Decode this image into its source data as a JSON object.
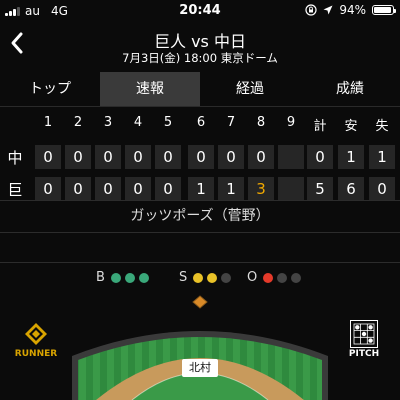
{
  "status": {
    "carrier": "au",
    "network": "4G",
    "time": "20:44",
    "battery": "94%",
    "battery_level": 0.94
  },
  "header": {
    "title": "巨人 vs 中日",
    "subtitle": "7月3日(金) 18:00 東京ドーム"
  },
  "tabs": [
    {
      "label": "トップ",
      "active": false
    },
    {
      "label": "速報",
      "active": true
    },
    {
      "label": "経過",
      "active": false
    },
    {
      "label": "成績",
      "active": false
    }
  ],
  "scoreboard": {
    "innings": [
      "1",
      "2",
      "3",
      "4",
      "5",
      "6",
      "7",
      "8",
      "9"
    ],
    "totals_headers": [
      "計",
      "安",
      "失"
    ],
    "teams": [
      {
        "name": "中",
        "innings": [
          "0",
          "0",
          "0",
          "0",
          "0",
          "0",
          "0",
          "0",
          ""
        ],
        "totals": [
          "0",
          "1",
          "1"
        ]
      },
      {
        "name": "巨",
        "innings": [
          "0",
          "0",
          "0",
          "0",
          "0",
          "1",
          "1",
          "3",
          ""
        ],
        "totals": [
          "5",
          "6",
          "0"
        ]
      }
    ]
  },
  "play": {
    "text": "ガッツポーズ（菅野）"
  },
  "count": {
    "balls_label": "B",
    "balls": 3,
    "balls_max": 3,
    "strikes_label": "S",
    "strikes": 2,
    "strikes_max": 3,
    "outs_label": "O",
    "outs": 1,
    "outs_max": 3
  },
  "runner_button": {
    "label": "RUNNER"
  },
  "pitch_button": {
    "label": "PITCH"
  },
  "field": {
    "player": "北村"
  },
  "colors": {
    "ball": "#3aa87a",
    "strike": "#e9c228",
    "out": "#e53a2a",
    "highlight": "#f0a800",
    "active_tab": "#3a3a3a"
  }
}
